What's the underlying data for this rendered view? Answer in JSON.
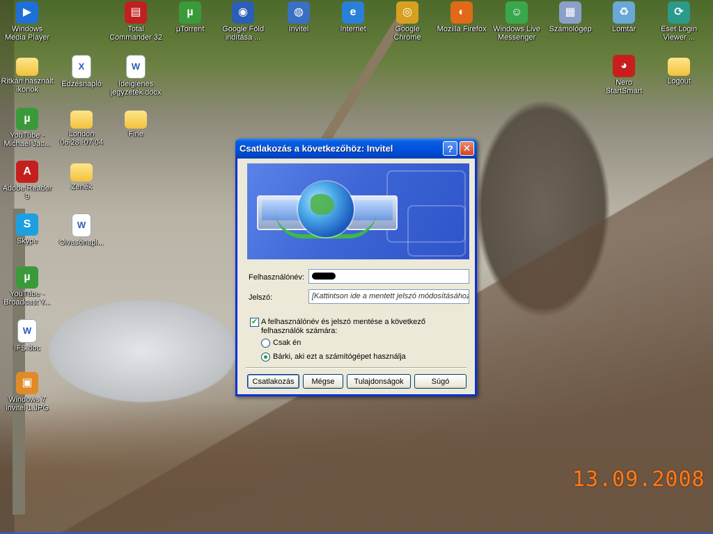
{
  "desktop": {
    "icons": [
      {
        "label": "Windows Media Player",
        "icon": "windows-media-player-icon",
        "color": "#1f6fd8",
        "glyph": "▶"
      },
      {
        "label": "Total Commander 32",
        "icon": "total-commander-icon",
        "color": "#c22020",
        "glyph": "▤"
      },
      {
        "label": "µTorrent",
        "icon": "utorrent-icon",
        "color": "#3a9a3a",
        "glyph": "µ"
      },
      {
        "label": "Google Föld indítása ...",
        "icon": "google-earth-icon",
        "color": "#2a5fb5",
        "glyph": "◉"
      },
      {
        "label": "Invitel",
        "icon": "dialup-connection-icon",
        "color": "#3a6fc4",
        "glyph": "◍"
      },
      {
        "label": "Internet",
        "icon": "internet-explorer-icon",
        "color": "#2a80d8",
        "glyph": "e"
      },
      {
        "label": "Google Chrome",
        "icon": "google-chrome-icon",
        "color": "#d8a020",
        "glyph": "◎"
      },
      {
        "label": "Mozilla Firefox",
        "icon": "firefox-icon",
        "color": "#e06a16",
        "glyph": "◐"
      },
      {
        "label": "Windows Live Messenger",
        "icon": "messenger-icon",
        "color": "#3aa84a",
        "glyph": "☺"
      },
      {
        "label": "Számológép",
        "icon": "calculator-icon",
        "color": "#8aa0c8",
        "glyph": "▦"
      },
      {
        "label": "Lomtár",
        "icon": "recycle-bin-icon",
        "color": "#6aa8d8",
        "glyph": "♻"
      },
      {
        "label": "Eset Login Viewer ...",
        "icon": "eset-login-viewer-icon",
        "color": "#2a9a8a",
        "glyph": "⟳"
      },
      {
        "label": "Ritkán használt ikonok",
        "icon": "folder-icon",
        "color": "#f2c23d",
        "glyph": ""
      },
      {
        "label": "Edzésnapló",
        "icon": "excel-document-icon",
        "color": "#2a7a3a",
        "glyph": "X"
      },
      {
        "label": "Ideiglenes jegyzetek.docx",
        "icon": "word-document-icon",
        "color": "#2a5bb7",
        "glyph": "W"
      },
      {
        "label": "Nero StartSmart",
        "icon": "nero-icon",
        "color": "#c81e1e",
        "glyph": "◕"
      },
      {
        "label": "Logout",
        "icon": "folder-icon",
        "color": "#f2c23d",
        "glyph": ""
      },
      {
        "label": "YouTube - Michael Jac...",
        "icon": "utorrent-file-icon",
        "color": "#3a9a3a",
        "glyph": "µ"
      },
      {
        "label": "London 06.28.-07.04",
        "icon": "folder-icon",
        "color": "#f2c23d",
        "glyph": ""
      },
      {
        "label": "Fine",
        "icon": "folder-icon",
        "color": "#f2c23d",
        "glyph": ""
      },
      {
        "label": "Adobe Reader 9",
        "icon": "adobe-reader-icon",
        "color": "#c41e1e",
        "glyph": "A"
      },
      {
        "label": "Zenék",
        "icon": "folder-icon",
        "color": "#f2c23d",
        "glyph": ""
      },
      {
        "label": "Skype",
        "icon": "skype-icon",
        "color": "#1ea0e0",
        "glyph": "S"
      },
      {
        "label": "Olvasónapl...",
        "icon": "word-document-icon",
        "color": "#2a5bb7",
        "glyph": "W"
      },
      {
        "label": "YouTube - Broadcast Y...",
        "icon": "utorrent-file-icon",
        "color": "#3a9a3a",
        "glyph": "µ"
      },
      {
        "label": "IFS.doc",
        "icon": "word-document-icon",
        "color": "#2a5bb7",
        "glyph": "W"
      },
      {
        "label": "Windows 7 invitel 1.JPG",
        "icon": "image-file-icon",
        "color": "#e08a2a",
        "glyph": "▣"
      }
    ],
    "date_stamp": "13.09.2008"
  },
  "dialog": {
    "title": "Csatlakozás a következőhöz: Invitel",
    "help_glyph": "?",
    "close_glyph": "✕",
    "username_label": "Felhasználónév:",
    "password_label": "Jelszó:",
    "password_placeholder": "[Kattintson ide a mentett jelszó módosításához]",
    "save_checkbox_label": "A felhasználónév és jelszó mentése a következő felhasználók számára:",
    "save_checked": true,
    "radio_only_me": "Csak én",
    "radio_anyone": "Bárki, aki ezt a számítógépet használja",
    "selected_radio": "anyone",
    "buttons": {
      "connect": "Csatlakozás",
      "cancel": "Mégse",
      "properties": "Tulajdonságok",
      "help": "Súgó"
    }
  }
}
